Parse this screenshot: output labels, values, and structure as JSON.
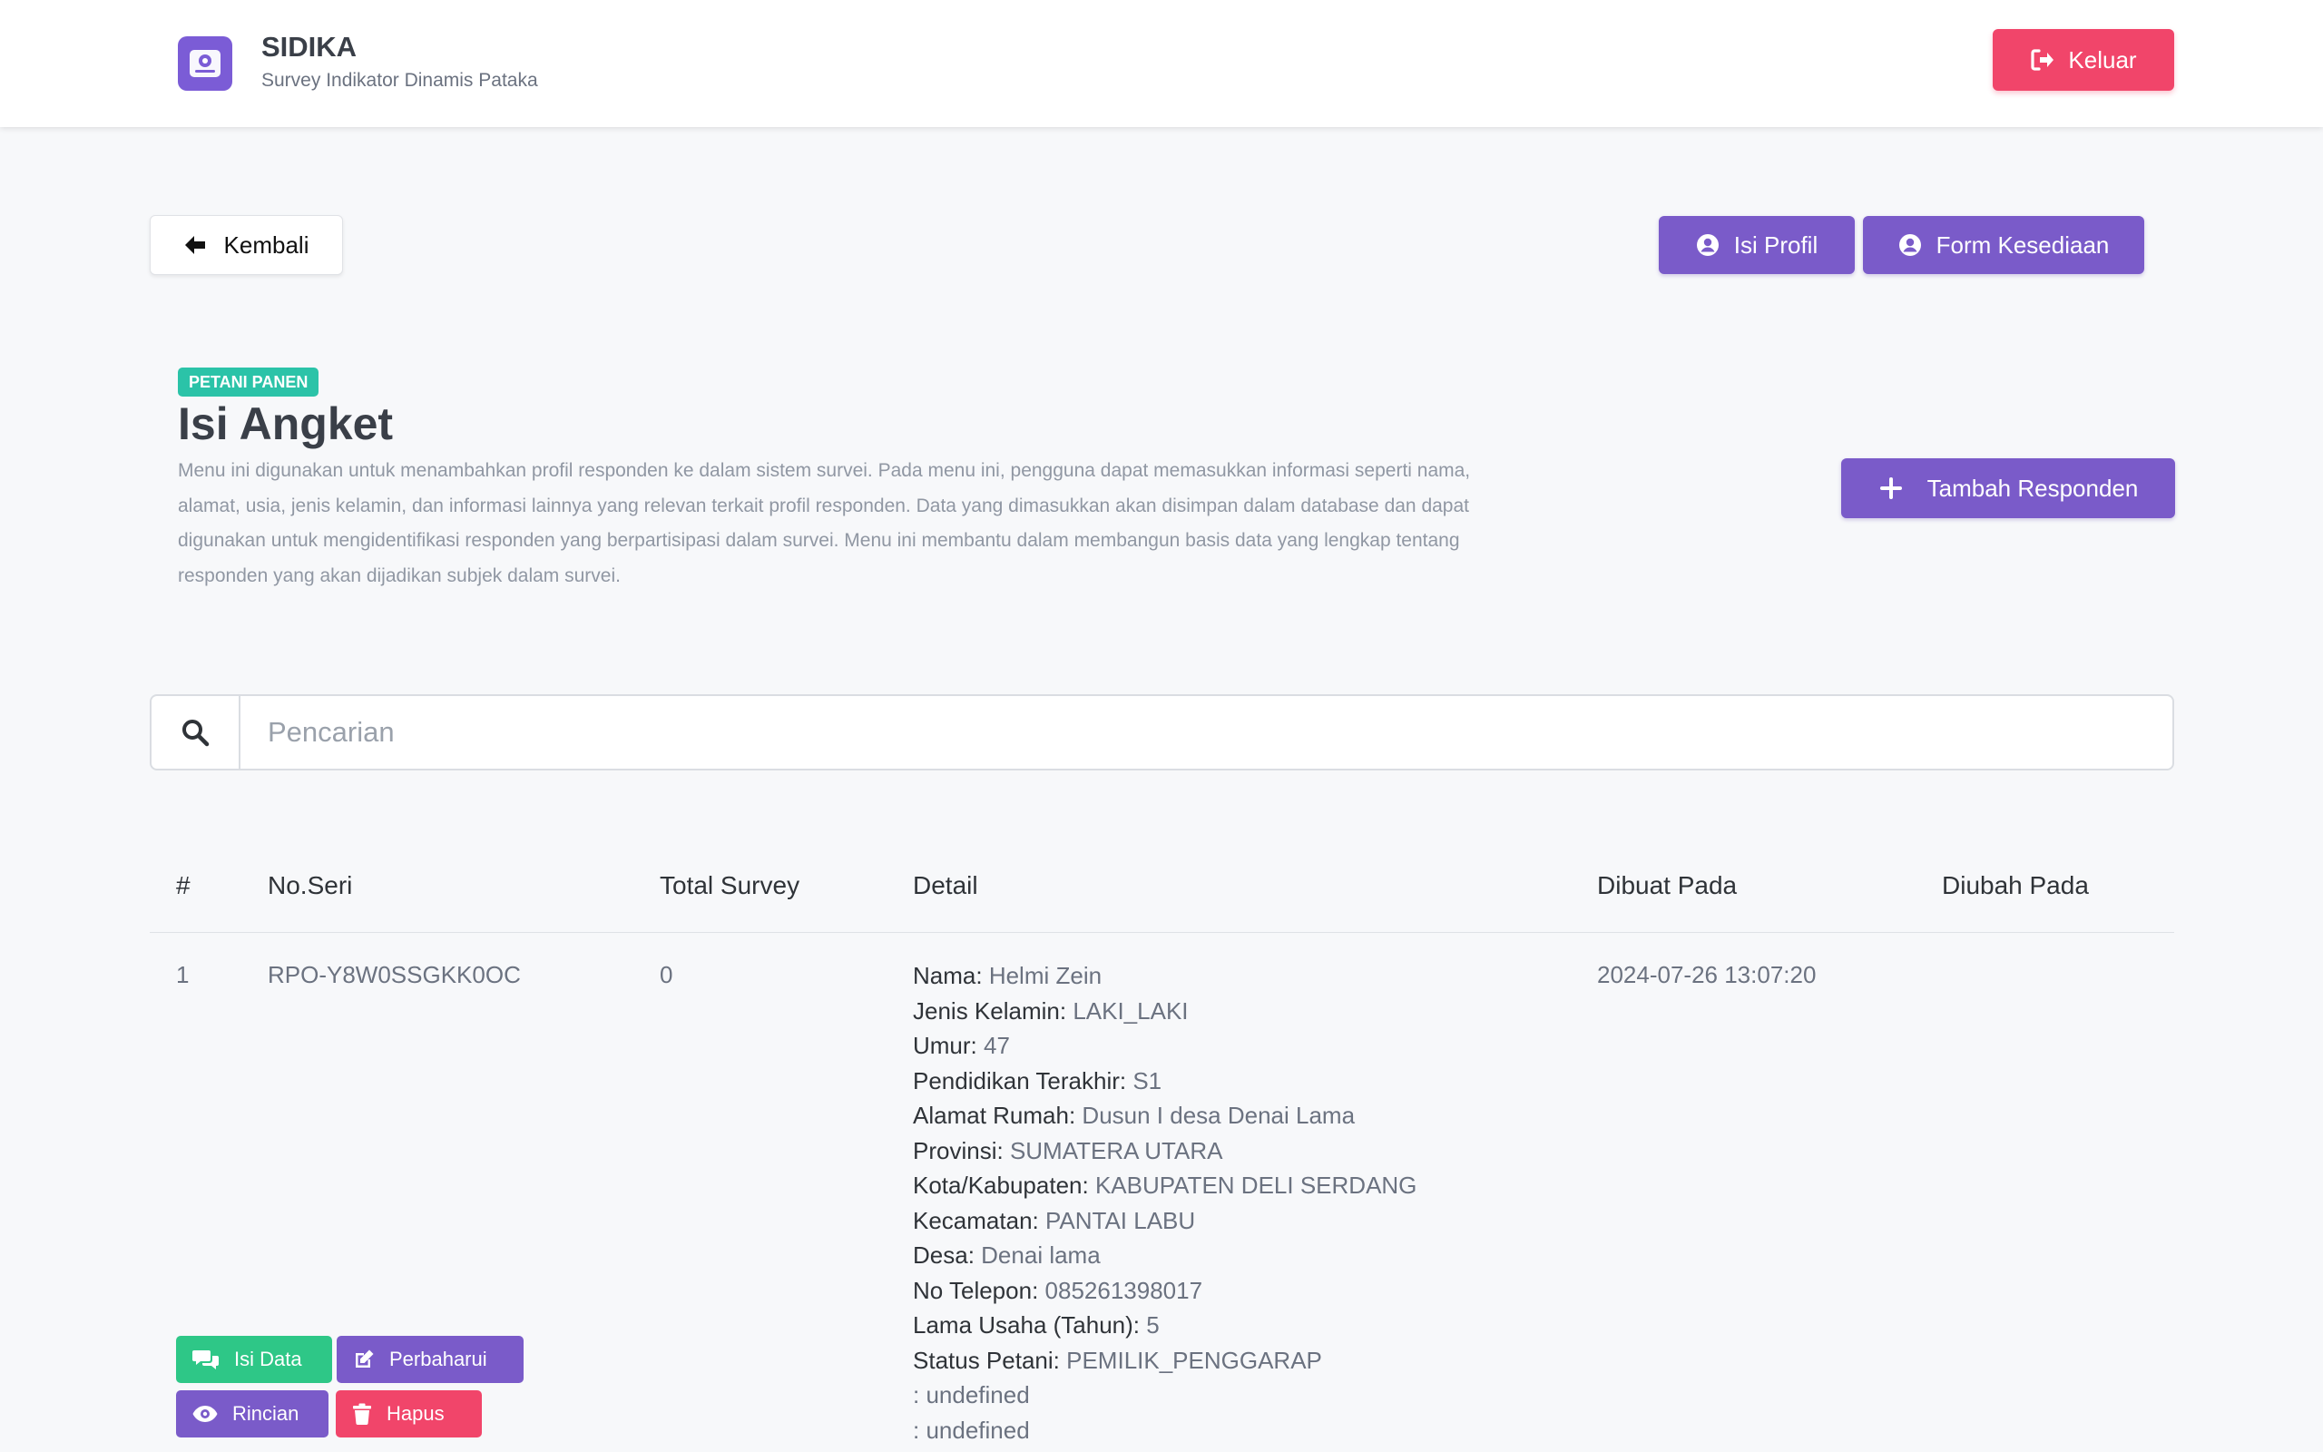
{
  "app": {
    "name": "SIDIKA",
    "subtitle": "Survey Indikator Dinamis Pataka",
    "logout_label": "Keluar"
  },
  "toolbar": {
    "back_label": "Kembali",
    "profile_label": "Isi Profil",
    "form_label": "Form Kesediaan"
  },
  "page": {
    "tag": "PETANI PANEN",
    "title": "Isi Angket",
    "description": "Menu ini digunakan untuk menambahkan profil responden ke dalam sistem survei. Pada menu ini, pengguna dapat memasukkan informasi seperti nama, alamat, usia, jenis kelamin, dan informasi lainnya yang relevan terkait profil responden. Data yang dimasukkan akan disimpan dalam database dan dapat digunakan untuk mengidentifikasi responden yang berpartisipasi dalam survei. Menu ini membantu dalam membangun basis data yang lengkap tentang responden yang akan dijadikan subjek dalam survei.",
    "add_label": "Tambah Responden"
  },
  "search": {
    "placeholder": "Pencarian",
    "value": ""
  },
  "table": {
    "headers": {
      "index": "#",
      "serial": "No.Seri",
      "total": "Total Survey",
      "detail": "Detail",
      "created": "Dibuat Pada",
      "updated": "Diubah Pada"
    },
    "rows": [
      {
        "index": "1",
        "serial": "RPO-Y8W0SSGKK0OC",
        "total": "0",
        "created": "2024-07-26 13:07:20",
        "updated": "",
        "details": [
          {
            "k": "Nama:",
            "v": "Helmi Zein"
          },
          {
            "k": "Jenis Kelamin:",
            "v": "LAKI_LAKI"
          },
          {
            "k": "Umur:",
            "v": "47"
          },
          {
            "k": "Pendidikan Terakhir:",
            "v": "S1"
          },
          {
            "k": "Alamat Rumah:",
            "v": "Dusun I desa Denai Lama"
          },
          {
            "k": "Provinsi:",
            "v": "SUMATERA UTARA"
          },
          {
            "k": "Kota/Kabupaten:",
            "v": "KABUPATEN DELI SERDANG"
          },
          {
            "k": "Kecamatan:",
            "v": "PANTAI LABU"
          },
          {
            "k": "Desa:",
            "v": "Denai lama"
          },
          {
            "k": "No Telepon:",
            "v": "085261398017"
          },
          {
            "k": "Lama Usaha (Tahun):",
            "v": "5"
          },
          {
            "k": "Status Petani:",
            "v": "PEMILIK_PENGGARAP"
          },
          {
            "k": "",
            "v": ": undefined"
          },
          {
            "k": "",
            "v": ": undefined"
          }
        ],
        "actions": {
          "fill": "Isi Data",
          "update": "Perbaharui",
          "details": "Rincian",
          "delete": "Hapus"
        }
      }
    ]
  },
  "colors": {
    "primary": "#7a5bc9",
    "danger": "#f1456a",
    "success": "#2ec787",
    "teal": "#2bc3a8"
  }
}
